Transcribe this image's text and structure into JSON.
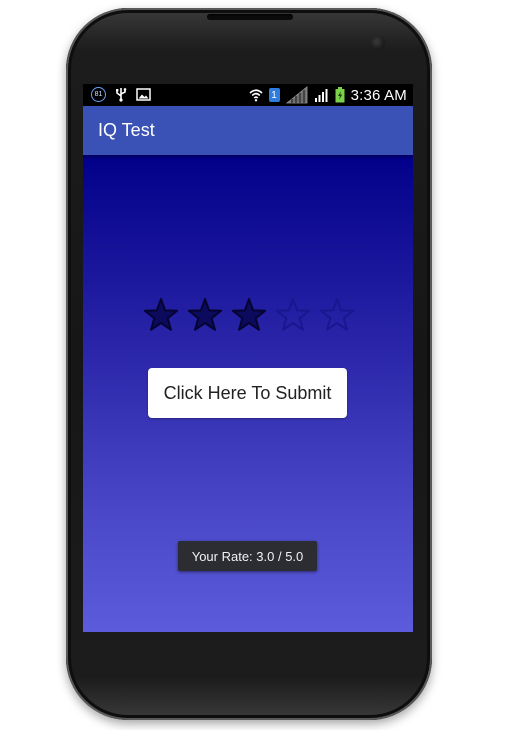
{
  "status_bar": {
    "notification_badge": "81",
    "time": "3:36 AM",
    "sim_badge": "1",
    "icons": [
      "notification-count-icon",
      "usb-icon",
      "image-icon",
      "wifi-icon",
      "sim-icon",
      "no-signal-icon",
      "signal-icon",
      "battery-charging-icon"
    ]
  },
  "app_bar": {
    "title": "IQ Test"
  },
  "rating": {
    "value": 3.0,
    "max": 5,
    "filled_color": "#0b0a5c",
    "empty_color": "#1a168f"
  },
  "submit_button": {
    "label": "Click Here To Submit"
  },
  "toast": {
    "text": "Your Rate: 3.0 / 5.0"
  },
  "colors": {
    "app_bar": "#3a52b5",
    "content_top": "#02008a",
    "content_bottom": "#5b5bdc"
  }
}
